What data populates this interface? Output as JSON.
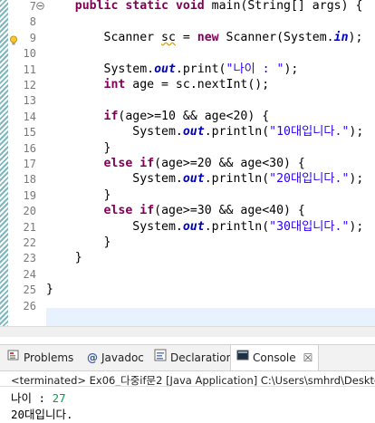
{
  "editor": {
    "lines": [
      {
        "n": "7",
        "segs": [
          {
            "t": "    "
          },
          {
            "t": "public",
            "c": "kw"
          },
          {
            "t": " "
          },
          {
            "t": "static",
            "c": "kw"
          },
          {
            "t": " "
          },
          {
            "t": "void",
            "c": "kw"
          },
          {
            "t": " main(String[] args) {"
          }
        ]
      },
      {
        "n": "8",
        "segs": []
      },
      {
        "n": "9",
        "segs": [
          {
            "t": "        Scanner "
          },
          {
            "t": "sc",
            "c": "warn"
          },
          {
            "t": " = "
          },
          {
            "t": "new",
            "c": "kw"
          },
          {
            "t": " Scanner(System."
          },
          {
            "t": "in",
            "c": "fi"
          },
          {
            "t": ");"
          }
        ]
      },
      {
        "n": "10",
        "segs": []
      },
      {
        "n": "11",
        "segs": [
          {
            "t": "        System."
          },
          {
            "t": "out",
            "c": "fi"
          },
          {
            "t": ".print("
          },
          {
            "t": "\"나이 : \"",
            "c": "st"
          },
          {
            "t": ");"
          }
        ]
      },
      {
        "n": "12",
        "segs": [
          {
            "t": "        "
          },
          {
            "t": "int",
            "c": "kw"
          },
          {
            "t": " age = sc.nextInt();"
          }
        ]
      },
      {
        "n": "13",
        "segs": []
      },
      {
        "n": "14",
        "segs": [
          {
            "t": "        "
          },
          {
            "t": "if",
            "c": "kw"
          },
          {
            "t": "(age>=10 && age<20) {"
          }
        ]
      },
      {
        "n": "15",
        "segs": [
          {
            "t": "            System."
          },
          {
            "t": "out",
            "c": "fi"
          },
          {
            "t": ".println("
          },
          {
            "t": "\"10대입니다.\"",
            "c": "st"
          },
          {
            "t": ");"
          }
        ]
      },
      {
        "n": "16",
        "segs": [
          {
            "t": "        }"
          }
        ]
      },
      {
        "n": "17",
        "segs": [
          {
            "t": "        "
          },
          {
            "t": "else",
            "c": "kw"
          },
          {
            "t": " "
          },
          {
            "t": "if",
            "c": "kw"
          },
          {
            "t": "(age>=20 && age<30) {"
          }
        ]
      },
      {
        "n": "18",
        "segs": [
          {
            "t": "            System."
          },
          {
            "t": "out",
            "c": "fi"
          },
          {
            "t": ".println("
          },
          {
            "t": "\"20대입니다.\"",
            "c": "st"
          },
          {
            "t": ");"
          }
        ]
      },
      {
        "n": "19",
        "segs": [
          {
            "t": "        }"
          }
        ]
      },
      {
        "n": "20",
        "segs": [
          {
            "t": "        "
          },
          {
            "t": "else",
            "c": "kw"
          },
          {
            "t": " "
          },
          {
            "t": "if",
            "c": "kw"
          },
          {
            "t": "(age>=30 && age<40) {"
          }
        ]
      },
      {
        "n": "21",
        "segs": [
          {
            "t": "            System."
          },
          {
            "t": "out",
            "c": "fi"
          },
          {
            "t": ".println("
          },
          {
            "t": "\"30대입니다.\"",
            "c": "st"
          },
          {
            "t": ");"
          }
        ]
      },
      {
        "n": "22",
        "segs": [
          {
            "t": "        }"
          }
        ]
      },
      {
        "n": "23",
        "segs": [
          {
            "t": "    }"
          }
        ]
      },
      {
        "n": "24",
        "segs": []
      },
      {
        "n": "25",
        "segs": [
          {
            "t": "}"
          }
        ]
      },
      {
        "n": "26",
        "segs": []
      }
    ],
    "fold_icon": "fold-collapse-icon",
    "warning_icon": "warning-lightbulb-icon"
  },
  "panel": {
    "tabs": [
      {
        "label": "Problems",
        "icon": "problems-icon"
      },
      {
        "label": "Javadoc",
        "icon": "javadoc-icon"
      },
      {
        "label": "Declaration",
        "icon": "declaration-icon"
      },
      {
        "label": "Console",
        "icon": "console-icon",
        "active": true
      }
    ],
    "close_glyph": "☒",
    "status": "<terminated> Ex06_다중if문2 [Java Application] C:\\Users\\smhrd\\Desktop",
    "output": {
      "line1_label": "나이 : ",
      "line1_input": "27",
      "line2": "20대입니다."
    }
  },
  "colors": {
    "keyword": "#7f0055",
    "string": "#2a00ff",
    "field": "#0000c0",
    "user_input": "#00a550",
    "current_line": "#e8f2fe"
  }
}
